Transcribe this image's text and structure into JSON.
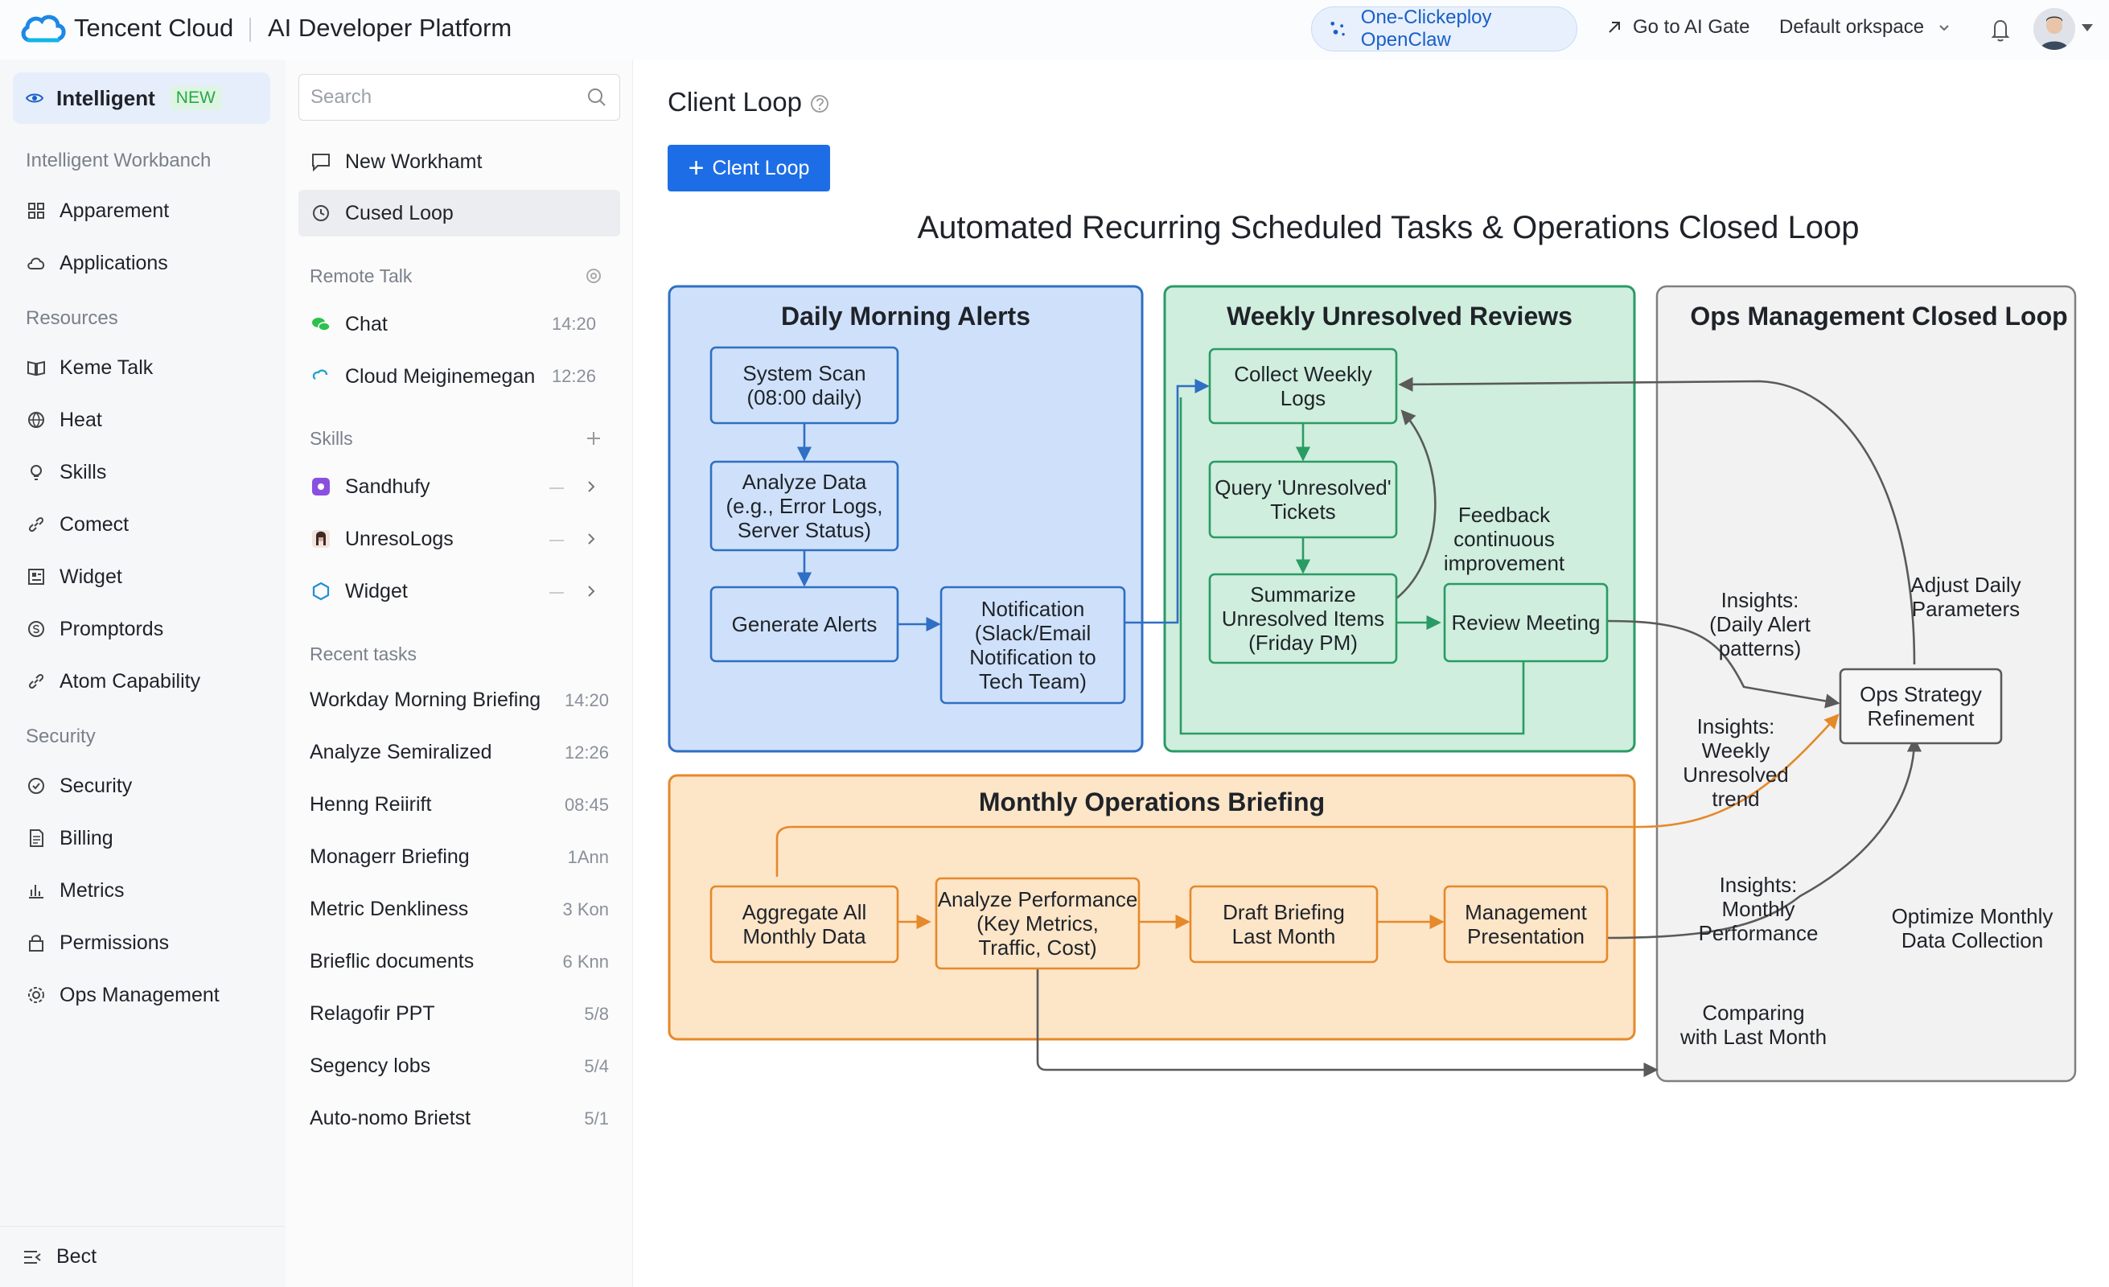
{
  "header": {
    "brand": "Tencent Cloud",
    "platform": "AI Developer Platform",
    "deploy_button": "One-Clickeploy OpenClaw",
    "ai_gate_link": "Go to AI Gate",
    "workspace": "Default orkspace"
  },
  "leftnav": {
    "active": {
      "label": "Intelligent",
      "badge": "NEW"
    },
    "sections": [
      {
        "title": "Intelligent Workbanch"
      },
      {
        "title": "Resources"
      },
      {
        "title": "Security"
      }
    ],
    "items": [
      {
        "label": "Apparement",
        "icon": "grid-icon"
      },
      {
        "label": "Applications",
        "icon": "cloud-icon"
      },
      {
        "label": "Keme Talk",
        "icon": "book-icon"
      },
      {
        "label": "Heat",
        "icon": "globe-icon"
      },
      {
        "label": "Skills",
        "icon": "bulb-icon"
      },
      {
        "label": "Comect",
        "icon": "link-icon"
      },
      {
        "label": "Widget",
        "icon": "widget-icon"
      },
      {
        "label": "Promptords",
        "icon": "dollar-icon"
      },
      {
        "label": "Atom Capability",
        "icon": "link-icon"
      },
      {
        "label": "Security",
        "icon": "check-circle-icon"
      },
      {
        "label": "Billing",
        "icon": "document-icon"
      },
      {
        "label": "Metrics",
        "icon": "bar-chart-icon"
      },
      {
        "label": "Permissions",
        "icon": "lock-icon"
      },
      {
        "label": "Ops Management",
        "icon": "gear-icon"
      }
    ],
    "bottom": {
      "label": "Bect",
      "icon": "collapse-icon"
    }
  },
  "middle": {
    "search_placeholder": "Search",
    "new_workhamt": "New Workhamt",
    "closed_loop": "Cused Loop",
    "remote_talk": {
      "title": "Remote Talk",
      "items": [
        {
          "label": "Chat",
          "time": "14:20"
        },
        {
          "label": "Cloud Meiginemegan",
          "time": "12:26"
        }
      ]
    },
    "skills": {
      "title": "Skills",
      "items": [
        {
          "label": "Sandhufy"
        },
        {
          "label": "UnresoLogs"
        },
        {
          "label": "Widget"
        }
      ]
    },
    "recent": {
      "title": "Recent tasks",
      "items": [
        {
          "label": "Workday Morning Briefing",
          "time": "14:20"
        },
        {
          "label": "Analyze Semiralized",
          "time": "12:26"
        },
        {
          "label": "Henng Reiirift",
          "time": "08:45"
        },
        {
          "label": "Monagerr Briefing",
          "time": "1Ann"
        },
        {
          "label": "Metric Denkliness",
          "time": "3 Kon"
        },
        {
          "label": "Brieflic documents",
          "time": "6 Knn"
        },
        {
          "label": "Relagofir PPT",
          "time": "5/8"
        },
        {
          "label": "Segency lobs",
          "time": "5/4"
        },
        {
          "label": "Auto-nomo Brietst",
          "time": "5/1"
        }
      ]
    }
  },
  "main": {
    "title": "Client Loop",
    "primary_button": "Clent Loop",
    "diagram": {
      "title": "Automated Recurring Scheduled Tasks & Operations Closed Loop",
      "panels": {
        "daily": "Daily Morning Alerts",
        "weekly": "Weekly Unresolved Reviews",
        "ops": "Ops Management Closed Loop",
        "monthly": "Monthly Operations Briefing"
      },
      "nodes": {
        "system_scan": [
          "System Scan",
          "(08:00 daily)"
        ],
        "analyze_data": [
          "Analyze Data",
          "(e.g., Error Logs,",
          "Server Status)"
        ],
        "generate_alerts": [
          "Generate Alerts"
        ],
        "notification": [
          "Notification",
          "(Slack/Email",
          "Notification to",
          "Tech Team)"
        ],
        "collect_logs": [
          "Collect Weekly",
          "Logs"
        ],
        "query_tickets": [
          "Query 'Unresolved'",
          "Tickets"
        ],
        "summarize": [
          "Summarize",
          "Unresolved Items",
          "(Friday PM)"
        ],
        "review_meeting": [
          "Review Meeting"
        ],
        "ops_strategy": [
          "Ops Strategy",
          "Refinement"
        ],
        "aggregate": [
          "Aggregate All",
          "Monthly Data"
        ],
        "analyze_perf": [
          "Analyze Performance",
          "(Key Metrics,",
          "Traffic, Cost)"
        ],
        "draft": [
          "Draft Briefing",
          "Last Month"
        ],
        "presentation": [
          "Management",
          "Presentation"
        ]
      },
      "labels": {
        "feedback": [
          "Feedback",
          "continuous",
          "improvement"
        ],
        "insights_daily": [
          "Insights:",
          "(Daily Alert",
          "patterns)"
        ],
        "adjust_daily": [
          "Adjust Daily",
          "Parameters"
        ],
        "insights_weekly": [
          "Insights:",
          "Weekly",
          "Unresolved",
          "trend"
        ],
        "insights_monthly": [
          "Insights:",
          "Monthly",
          "Performance"
        ],
        "optimize_monthly": [
          "Optimize Monthly",
          "Data Collection"
        ],
        "comparing": [
          "Comparing",
          "with Last Month"
        ]
      },
      "colors": {
        "blue": "#2f6fc4",
        "green": "#2a9b63",
        "orange": "#e5892a",
        "gray": "#5a5a5a"
      }
    }
  }
}
